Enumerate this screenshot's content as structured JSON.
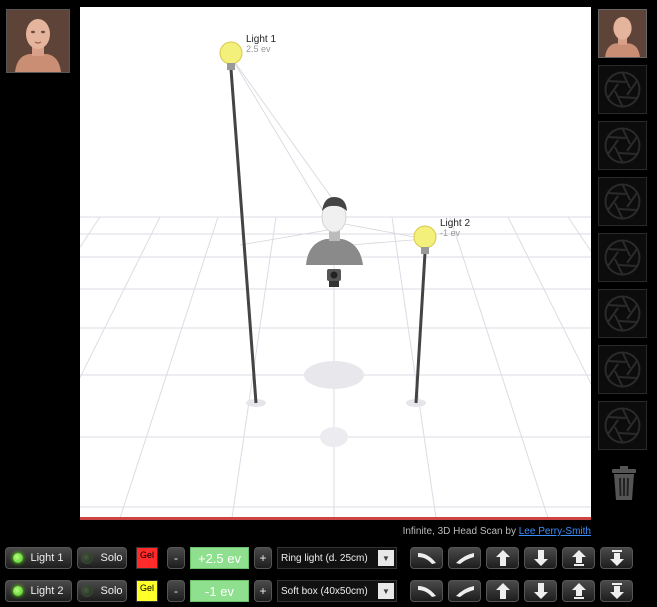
{
  "credit": {
    "text": "Infinite, 3D Head Scan by ",
    "author": "Lee Perry-Smith"
  },
  "lights_in_scene": [
    {
      "name": "Light 1",
      "ev": "2.5 ev"
    },
    {
      "name": "Light 2",
      "ev": "-1 ev"
    }
  ],
  "controls": [
    {
      "light_label": "Light 1",
      "light_on": true,
      "solo_label": "Solo",
      "gel_label": "Gel",
      "gel_color": "#ff2a2a",
      "minus_label": "-",
      "ev_value": "+2.5 ev",
      "plus_label": "+",
      "modifier": "Ring light (d. 25cm)"
    },
    {
      "light_label": "Light 2",
      "light_on": true,
      "solo_label": "Solo",
      "gel_label": "Gel",
      "gel_color": "#ffff2a",
      "minus_label": "-",
      "ev_value": "-1 ev",
      "plus_label": "+",
      "modifier": "Soft box (40x50cm)"
    }
  ],
  "icons": {
    "thumbnails": [
      "head-thumbnail-icon",
      "aperture-icon",
      "aperture-icon",
      "aperture-icon",
      "aperture-icon",
      "aperture-icon",
      "aperture-icon",
      "aperture-icon"
    ],
    "trash": "trash-icon",
    "row_buttons": [
      "rotate-left-icon",
      "rotate-right-icon",
      "move-up-icon",
      "move-down-icon",
      "raise-icon",
      "lower-icon"
    ]
  },
  "colors": {
    "ev_field": "#8ee08e",
    "stage_background": "#ffffff",
    "led_on": "#3fbf22"
  }
}
